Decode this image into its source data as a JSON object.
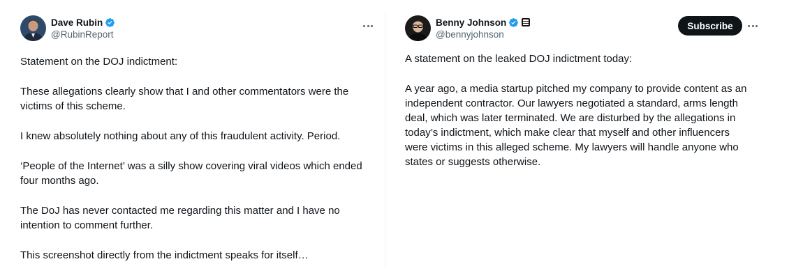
{
  "posts": [
    {
      "author": {
        "display_name": "Dave Rubin",
        "handle": "@RubinReport",
        "verified": true
      },
      "paragraphs": [
        "Statement on the DOJ indictment:",
        "These allegations clearly show that I and other commentators were the victims of this scheme.",
        "I knew absolutely nothing about any of this fraudulent activity. Period.",
        "‘People of the Internet’ was a silly show covering viral videos which ended four months ago.",
        "The DoJ has never contacted me regarding this matter and I have no intention to comment further.",
        "This screenshot directly from the indictment speaks for itself…"
      ],
      "more_icon": "more-horizontal-icon"
    },
    {
      "author": {
        "display_name": "Benny Johnson",
        "handle": "@bennyjohnson",
        "verified": true,
        "affiliate_badge": true
      },
      "subscribe_label": "Subscribe",
      "paragraphs": [
        "A statement on the leaked DOJ indictment today:",
        "A year ago, a media startup pitched my company to provide content as an independent contractor. Our lawyers negotiated a standard, arms length deal, which was later terminated. We are disturbed by the allegations in today’s indictment, which make clear that myself and other influencers were victims in this alleged scheme. My lawyers will handle anyone who states or suggests otherwise."
      ],
      "more_icon": "more-horizontal-icon"
    }
  ],
  "colors": {
    "verified_blue": "#1d9bf0",
    "text": "#0f1419",
    "secondary": "#536471",
    "button_bg": "#0f1419"
  }
}
